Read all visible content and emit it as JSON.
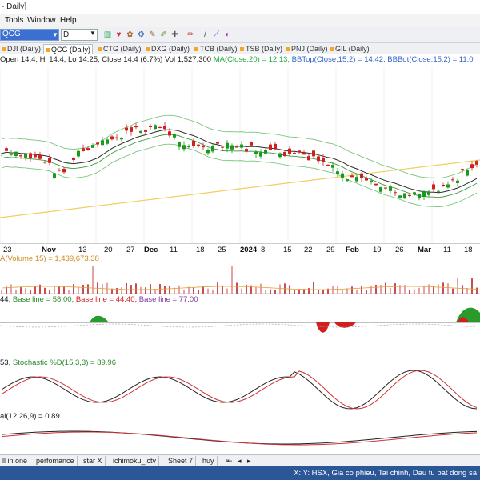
{
  "window": {
    "title": "- Daily]"
  },
  "menu": [
    "Tools",
    "Window",
    "Help"
  ],
  "toolbar": {
    "symbol": "QCG",
    "timeframe": "D"
  },
  "tabs": [
    {
      "label": "DJI (Daily)",
      "active": false
    },
    {
      "label": "QCG (Daily)",
      "active": true
    },
    {
      "label": "CTG (Daily)",
      "active": false
    },
    {
      "label": "DXG (Daily)",
      "active": false
    },
    {
      "label": "TCB (Daily)",
      "active": false
    },
    {
      "label": "TSB (Daily)",
      "active": false
    },
    {
      "label": "PNJ (Daily)",
      "active": false
    },
    {
      "label": "GIL (Daily)",
      "active": false
    }
  ],
  "info": {
    "ohlc": "Open 14.4, Hi 14.4, Lo 14.25, Close 14.4 (6.7%) Vol 1,527,300",
    "ma": "MA(Close,20) = 12.13,",
    "bbtop": "BBTop(Close,15,2) = 14.42,",
    "bbbot": "BBBot(Close,15,2) = 11.0"
  },
  "date_axis": [
    "23",
    "Nov",
    "13",
    "20",
    "27",
    "Dec",
    "11",
    "18",
    "25",
    "2024",
    "8",
    "15",
    "22",
    "29",
    "Feb",
    "19",
    "26",
    "Mar",
    "11",
    "18"
  ],
  "panels": {
    "volume": "A(Volume,15) = 1,439,673.38",
    "baseline": {
      "prefix": "44,",
      "b1": "Base line = 58.00,",
      "b2": "Base line = 44.40,",
      "b3": "Base line = 77.00"
    },
    "stochastic": {
      "prefix": "53,",
      "d": "Stochastic %D(15,3,3) = 89.96"
    },
    "macd": "al(12,26,9) = 0.89"
  },
  "sheets": [
    "ll in one",
    "perfomance",
    "star X",
    "ichimoku_lctv",
    "Sheet 7",
    "huy"
  ],
  "status": "X: Y: HSX, Gia co phieu, Tai chinh, Dau tu bat dong sa",
  "colors": {
    "up": "#1a9a1a",
    "down": "#d11f1f",
    "ma": "#2a2a2a",
    "bb": "#6cc06c",
    "trend": "#f0d060",
    "accent": "#2b5797"
  }
}
